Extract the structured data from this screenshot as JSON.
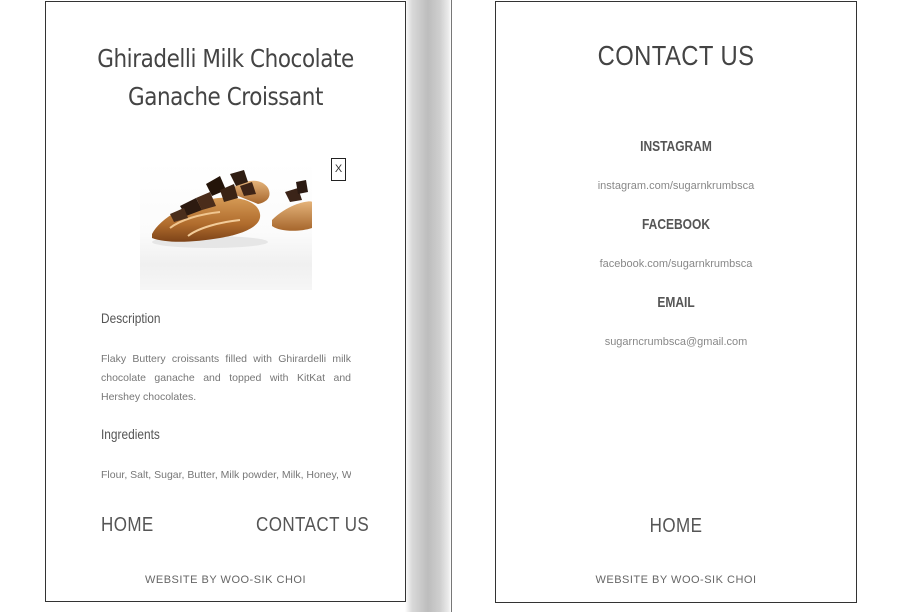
{
  "product": {
    "title": "Ghiradelli Milk Chocolate Ganache Croissant",
    "close_label": "X",
    "image_alt": "croissant-photo",
    "description_heading": "Description",
    "description_text": "Flaky Buttery croissants filled with Ghirardelli milk chocolate ganache and topped with KitKat and Hershey chocolates.",
    "ingredients_heading": "Ingredients",
    "ingredients_text": "Flour, Salt, Sugar, Butter, Milk powder, Milk, Honey, Water,"
  },
  "left_nav": {
    "home": "HOME",
    "contact": "CONTACT US"
  },
  "contact": {
    "title": "CONTACT US",
    "instagram_label": "INSTAGRAM",
    "instagram_value": "instagram.com/sugarnkrumbsca",
    "facebook_label": "FACEBOOK",
    "facebook_value": "facebook.com/sugarnkrumbsca",
    "email_label": "EMAIL",
    "email_value": "sugarncrumbsca@gmail.com"
  },
  "right_nav": {
    "home": "HOME"
  },
  "footer": {
    "credit": "WEBSITE BY WOO-SIK CHOI"
  },
  "colors": {
    "text": "#444444",
    "muted": "#777777",
    "border": "#333333",
    "shadow": "#bdbdbd"
  }
}
